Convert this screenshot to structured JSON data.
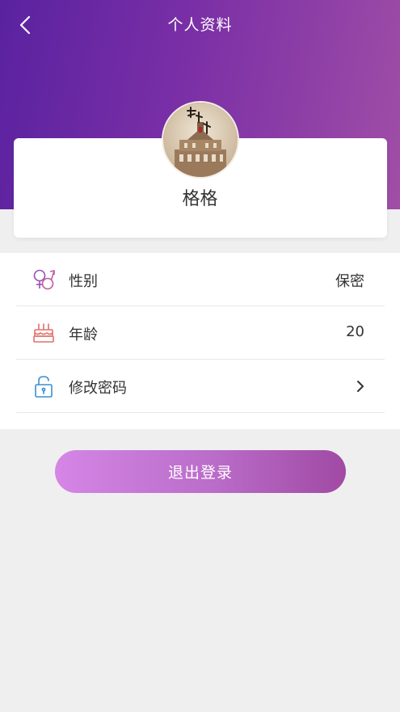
{
  "header": {
    "title": "个人资料",
    "back_icon": "chevron-left-icon",
    "gradient_start": "#5a22a0",
    "gradient_end": "#a04ea6"
  },
  "profile": {
    "username": "格格",
    "avatar_icon": "avatar-image"
  },
  "list": {
    "items": [
      {
        "icon": "gender-icon",
        "label": "性别",
        "value": "保密"
      },
      {
        "icon": "birthday-cake-icon",
        "label": "年龄",
        "value": "20"
      },
      {
        "icon": "lock-icon",
        "label": "修改密码",
        "value": ""
      }
    ]
  },
  "actions": {
    "logout_label": "退出登录",
    "logout_color": "#b96cc8"
  }
}
